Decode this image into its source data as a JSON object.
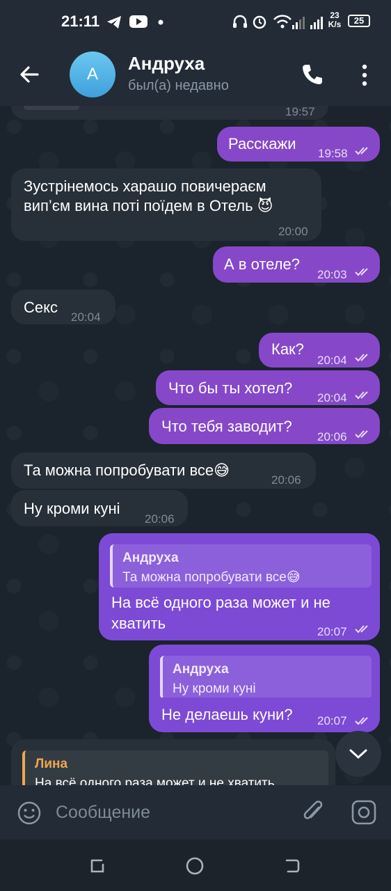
{
  "status": {
    "time": "21:11",
    "speed": "23",
    "speed_unit": "K/s",
    "battery": "25"
  },
  "header": {
    "avatar_letter": "А",
    "name": "Андруха",
    "status": "был(а) недавно"
  },
  "messages": [
    {
      "dir": "in",
      "text": "",
      "time": "19:57"
    },
    {
      "dir": "out",
      "text": "Расскажи",
      "time": "19:58"
    },
    {
      "dir": "in",
      "line1": "Зустрінемось харашо повичераєм",
      "line2": "вип’єм вина поті поїдем в Отель 😈",
      "time": "20:00"
    },
    {
      "dir": "out",
      "text": "А в отеле?",
      "time": "20:03"
    },
    {
      "dir": "in",
      "text": "Секс",
      "time": "20:04"
    },
    {
      "dir": "out",
      "text": "Как?",
      "time": "20:04"
    },
    {
      "dir": "out",
      "text": "Что бы ты хотел?",
      "time": "20:04"
    },
    {
      "dir": "out",
      "text": "Что тебя заводит?",
      "time": "20:06"
    },
    {
      "dir": "in",
      "text": "Та можна попробувати все😅",
      "time": "20:06"
    },
    {
      "dir": "in",
      "text": "Ну кроми куні",
      "time": "20:06"
    },
    {
      "dir": "out",
      "reply_name": "Андруха",
      "reply_text": "Та можна попробувати все😅",
      "line1": "На всё одного раза может и не",
      "line2": "хватить",
      "time": "20:07"
    },
    {
      "dir": "out",
      "reply_name": "Андруха",
      "reply_text": "Ну кроми куні",
      "text": "Не делаешь куни?",
      "time": "20:07"
    },
    {
      "dir": "in",
      "reply_name": "Лина",
      "reply_text": "На всё одного раза может и не хватить"
    }
  ],
  "composer": {
    "placeholder": "Сообщение"
  },
  "colors": {
    "outgoing": "#8648c9",
    "incoming": "#272f38",
    "header": "#222b36"
  },
  "icons": [
    "back-arrow-icon",
    "phone-icon",
    "more-vert-icon",
    "emoji-icon",
    "attach-icon",
    "camera-icon",
    "chevron-down-icon"
  ]
}
